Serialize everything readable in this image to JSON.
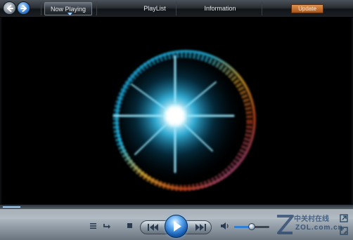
{
  "header": {
    "tabs": [
      {
        "label": "Now Playing",
        "selected": true
      },
      {
        "label": "PlayList"
      },
      {
        "label": "Information"
      }
    ],
    "update_label": "Update"
  },
  "playback": {
    "seek_progress_fraction": 0.05,
    "volume_fraction": 0.5
  },
  "icons": {
    "nav": [
      "back-arrow-icon",
      "forward-arrow-icon"
    ],
    "controls": [
      "playlist-menu-icon",
      "repeat-icon",
      "stop-icon",
      "previous-icon",
      "play-icon",
      "next-icon",
      "speaker-icon",
      "switch-to-compact-icon",
      "fullscreen-icon"
    ]
  },
  "watermark": {
    "line1": "中关村在线",
    "line2": "ZOL.com.cn"
  },
  "colors": {
    "accent_blue": "#2f7fd6",
    "update_orange": "#c56b2a",
    "visualizer_cyan": "#33c8ff"
  }
}
